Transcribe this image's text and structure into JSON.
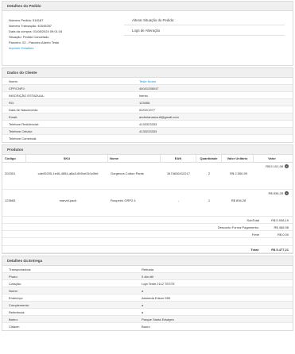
{
  "order": {
    "title": "Detalhes do Pedido",
    "number": "Número Pedido: 518187",
    "transaction": "Número Transação: 40049287",
    "purchase_date": "Data da compra: 01/08/2024 09:01:34",
    "status": "Situação: Pedido Cancelado",
    "partner": "Parceiro: 02 - Parceiro Aberto Teste",
    "print_link": "Imprimir Detalhes",
    "actions": [
      "Alterar Situação do Pedido:",
      "Logs de Alteração"
    ]
  },
  "client": {
    "title": "Dados do Cliente",
    "rows": [
      {
        "k": "Nome:",
        "v": "Teste Nome",
        "link": true
      },
      {
        "k": "CPF/CNPJ:",
        "v": "44041336047"
      },
      {
        "k": "INSCRIÇÃO ESTADUAL:",
        "v": "Isento"
      },
      {
        "k": "RG:",
        "v": "123456"
      },
      {
        "k": "Data de Nascimento:",
        "v": "02/02/1977"
      },
      {
        "k": "Email:",
        "v": "andreiamanoulf@gmail.com"
      },
      {
        "k": "Telefone Residencial:",
        "v": "4133323333"
      },
      {
        "k": "Telefone Celular:",
        "v": "4133233333"
      },
      {
        "k": "Telefone Comercial:",
        "v": ""
      }
    ]
  },
  "products": {
    "title": "Produtos",
    "headers": [
      "Código",
      "SKU",
      "Nome",
      "EAN",
      "Quantidade",
      "Valor Unitário",
      "Valor"
    ],
    "rows": [
      {
        "code": "202301",
        "sku": "cde05205-1e46-4854-a8a3-669ce310c0b6",
        "name": "Gorgeous Cotton Pants",
        "ean": "3474636412217",
        "qty": "2",
        "unit": "R$ 2.550,99",
        "total": "R$ 5.101,98"
      },
      {
        "code": "123665",
        "sku": "marvel-pack",
        "name": "Roupeiro GRP2.4",
        "ean": "-",
        "qty": "1",
        "unit": "R$ 836,28",
        "total": "R$ 836,28"
      }
    ],
    "subtotal_label": "SubTotal",
    "subtotal": "R$ 5.938,19",
    "discount_label": "Desconto Forma Pagamento:",
    "discount": "R$ 466,98",
    "freight_label": "Frete",
    "freight": "R$ 0,00",
    "total_label": "Total:",
    "total": "R$ 5.477,21"
  },
  "delivery": {
    "title": "Detalhes da Entrega",
    "rows": [
      {
        "k": "Transportadora:",
        "v": "Retirada"
      },
      {
        "k": "Prazo:",
        "v": "0 dia útil"
      },
      {
        "k": "Cotação:",
        "v": "Loja Teste 2112 TESTE"
      },
      {
        "k": "Nome:",
        "v": "a"
      },
      {
        "k": "Endereço:",
        "v": "Alameda Edson 555"
      },
      {
        "k": "Complemento:",
        "v": "a"
      },
      {
        "k": "Referência:",
        "v": "a"
      },
      {
        "k": "Bairro:",
        "v": "Parque Santa Edwiges"
      },
      {
        "k": "Cidade:",
        "v": "Bauru"
      }
    ]
  }
}
